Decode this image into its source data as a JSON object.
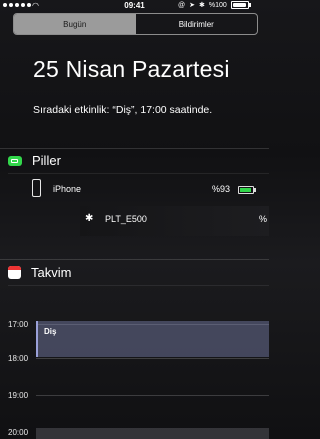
{
  "status_bar": {
    "time": "09:41",
    "battery_text": "%100",
    "icons": [
      "signal-dots-icon",
      "wifi-icon",
      "at-icon",
      "location-icon",
      "bluetooth-icon",
      "battery-icon"
    ]
  },
  "tabs": [
    "Bugün",
    "Bildirimler"
  ],
  "today": {
    "date": "25 Nisan Pazartesi",
    "next_event": "Sıradaki etkinlik: “Diş”, 17:00 saatinde."
  },
  "batteries": {
    "title": "Piller",
    "devices": [
      {
        "name": "iPhone",
        "percent_label": "%93",
        "level": 0.93,
        "icon": "iphone-icon"
      },
      {
        "name": "PLT_E500",
        "percent_label": "%",
        "icon": "bluetooth-icon"
      }
    ]
  },
  "calendar": {
    "title": "Takvim",
    "hours": [
      "17:00",
      "18:00",
      "19:00",
      "20:00"
    ],
    "event": {
      "title": "Diş",
      "color": "#7d82af"
    }
  },
  "colors": {
    "green": "#32d74b",
    "red": "#e33333"
  }
}
